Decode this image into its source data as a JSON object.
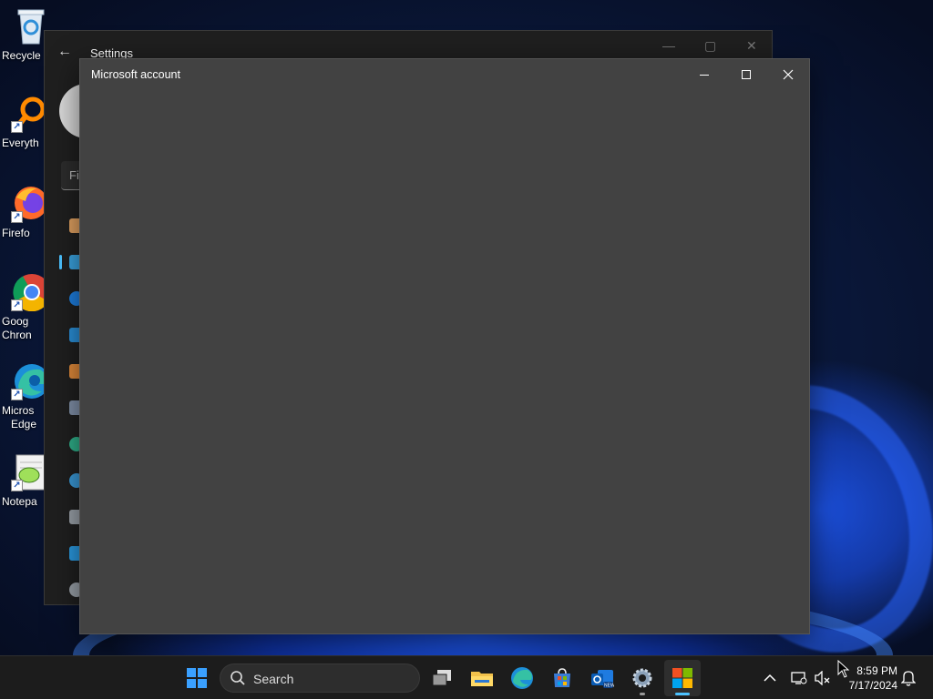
{
  "desktop_icons": [
    {
      "label": "Recycle",
      "icon": "recycle-bin-icon"
    },
    {
      "label": "Everyth",
      "icon": "everything-search-icon"
    },
    {
      "label": "Firefo",
      "icon": "firefox-icon"
    },
    {
      "label_line1": "Goog",
      "label_line2": "Chron",
      "icon": "chrome-icon"
    },
    {
      "label_line1": "Micros",
      "label_line2": "Edge",
      "icon": "edge-icon"
    },
    {
      "label": "Notepa",
      "icon": "notepad-plus-icon"
    }
  ],
  "settings_window": {
    "title": "Settings",
    "search_placeholder": "Fi"
  },
  "dialog": {
    "title": "Microsoft account"
  },
  "taskbar": {
    "search_label": "Search",
    "apps": [
      "start-icon",
      "task-view-icon",
      "file-explorer-icon",
      "edge-icon",
      "store-icon",
      "outlook-icon",
      "settings-icon",
      "microsoft-store-icon"
    ]
  },
  "tray": {
    "time": "8:59 PM",
    "date": "7/17/2024"
  },
  "colors": {
    "dialog_bg": "#424242",
    "taskbar_bg": "#1c1c1c",
    "accent": "#4cc2ff"
  }
}
